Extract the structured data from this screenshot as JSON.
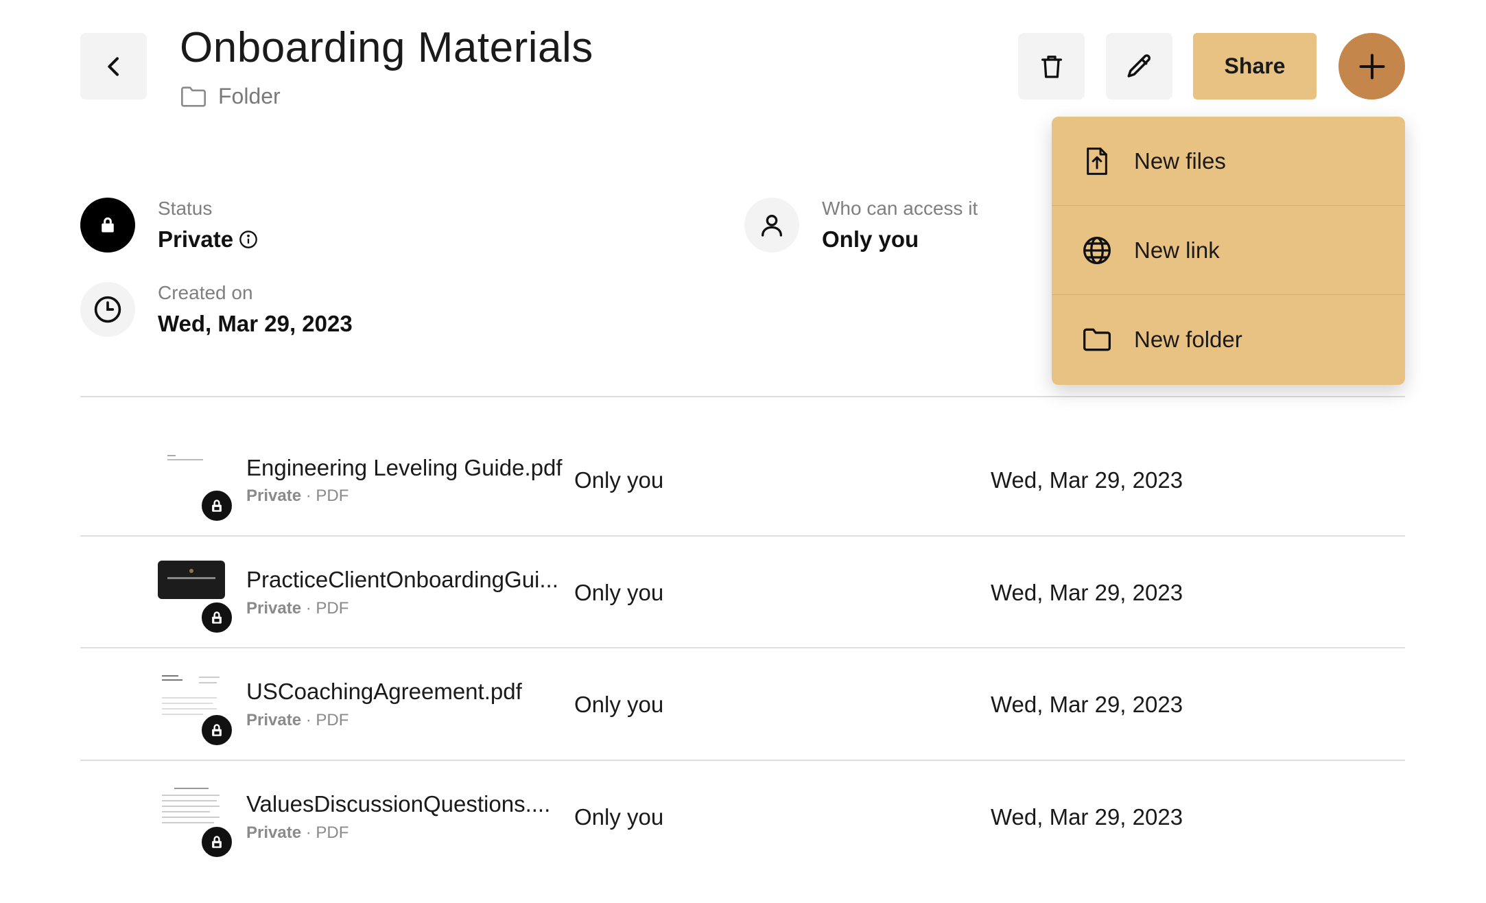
{
  "header": {
    "title": "Onboarding Materials",
    "type_label": "Folder",
    "share_label": "Share"
  },
  "menu": {
    "items": [
      {
        "label": "New files",
        "icon": "file-upload-icon"
      },
      {
        "label": "New link",
        "icon": "globe-icon"
      },
      {
        "label": "New folder",
        "icon": "folder-icon"
      }
    ]
  },
  "info": {
    "status_label": "Status",
    "status_value": "Private",
    "access_label": "Who can access it",
    "access_value": "Only you",
    "created_label": "Created on",
    "created_value": "Wed, Mar 29, 2023"
  },
  "files": [
    {
      "name": "Engineering Leveling Guide.pdf",
      "privacy": "Private",
      "type": "PDF",
      "access": "Only you",
      "date": "Wed, Mar 29, 2023"
    },
    {
      "name": "PracticeClientOnboardingGui...",
      "privacy": "Private",
      "type": "PDF",
      "access": "Only you",
      "date": "Wed, Mar 29, 2023"
    },
    {
      "name": "USCoachingAgreement.pdf",
      "privacy": "Private",
      "type": "PDF",
      "access": "Only you",
      "date": "Wed, Mar 29, 2023"
    },
    {
      "name": "ValuesDiscussionQuestions....",
      "privacy": "Private",
      "type": "PDF",
      "access": "Only you",
      "date": "Wed, Mar 29, 2023"
    }
  ],
  "meta_separator": " · ",
  "colors": {
    "share": "#e8c282",
    "add": "#c4864a",
    "menu": "#e8c282"
  }
}
